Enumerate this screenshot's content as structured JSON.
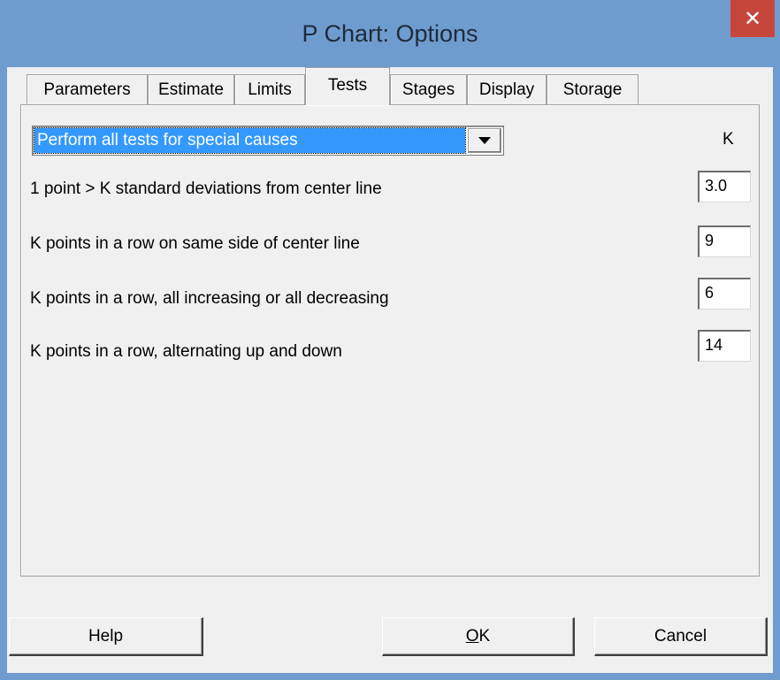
{
  "window": {
    "title": "P Chart: Options",
    "close_glyph": "✕"
  },
  "tabs": [
    {
      "label": "Parameters",
      "active": false
    },
    {
      "label": "Estimate",
      "active": false
    },
    {
      "label": "Limits",
      "active": false
    },
    {
      "label": "Tests",
      "active": true
    },
    {
      "label": "Stages",
      "active": false
    },
    {
      "label": "Display",
      "active": false
    },
    {
      "label": "Storage",
      "active": false
    }
  ],
  "tests": {
    "mode_selected": "Perform all tests for special causes",
    "k_header": "K",
    "rows": [
      {
        "label": "1 point > K standard deviations from center line",
        "k": "3.0"
      },
      {
        "label": "K points in a row on same side of center line",
        "k": "9"
      },
      {
        "label": "K points in a row, all increasing or all decreasing",
        "k": "6"
      },
      {
        "label": "K points in a row, alternating up and down",
        "k": "14"
      }
    ]
  },
  "buttons": {
    "help": "Help",
    "ok_underlined": "O",
    "ok_rest": "K",
    "cancel": "Cancel"
  },
  "colors": {
    "titlebar": "#6f9ccf",
    "close": "#c7463c",
    "selection": "#3399ff",
    "dialog": "#f0f0f0"
  }
}
